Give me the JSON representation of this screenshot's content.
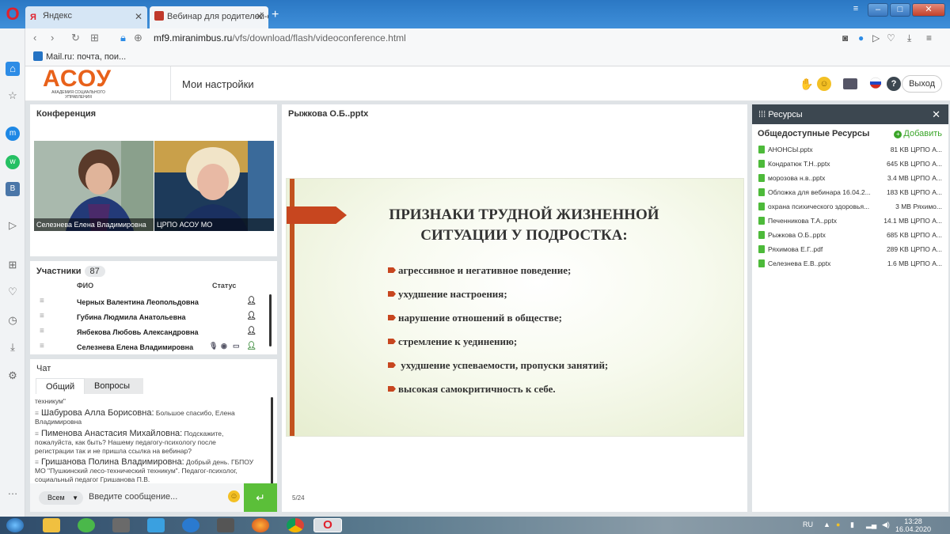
{
  "browser": {
    "tabs": [
      {
        "label": "Яндекс"
      },
      {
        "label": "Вебинар для родителей-с"
      }
    ],
    "url": {
      "host": "mf9.miranimbus.ru",
      "path": "/vfs/download/flash/videoconference.html"
    },
    "bookmark": "Mail.ru: почта, пои..."
  },
  "app": {
    "logo_text": "АСОУ",
    "logo_sub": "АКАДЕМИЯ СОЦИАЛЬНОГО УПРАВЛЕНИЯ",
    "settings_label": "Мои настройки",
    "exit_label": "Выход"
  },
  "conference": {
    "title": "Конференция",
    "videos": [
      {
        "name": "Селезнева Елена  Владимировна"
      },
      {
        "name": "ЦРПО АСОУ МО"
      }
    ]
  },
  "participants": {
    "title": "Участники",
    "count": "87",
    "col_name": "ФИО",
    "col_status": "Статус",
    "rows": [
      {
        "name": "Черных Валентина Леопольдовна"
      },
      {
        "name": "Губина Людмила Анатольевна"
      },
      {
        "name": "Янбекова Любовь Александровна"
      },
      {
        "name": "Селезнева Елена  Владимировна"
      }
    ]
  },
  "chat": {
    "title": "Чат",
    "tabs": [
      "Общий",
      "Вопросы"
    ],
    "messages": [
      {
        "author": "",
        "text": "техникум\""
      },
      {
        "author": "Шабурова Алла Борисовна:",
        "text": "Большое спасибо, Елена Владимировна"
      },
      {
        "author": "Пименова Анастасия Михайловна:",
        "text": "Подскажите, пожалуйста, как быть? Нашему педагогу-психологу после регистрации так и не пришла ссылка на вебинар?"
      },
      {
        "author": "Гришанова Полина Владимировна:",
        "text": "Добрый день. ГБПОУ МО \"Пушкинский лесо-технический техникум\". Педагог-психолог, социальный педагог Гришанова П.В."
      }
    ],
    "audience": "Всем",
    "input_placeholder": "Введите сообщение..."
  },
  "presentation": {
    "title": "Рыжкова О.Б..pptx",
    "slide_heading_1": "ПРИЗНАКИ ТРУДНОЙ ЖИЗНЕННОЙ",
    "slide_heading_2": "СИТУАЦИИ  У ПОДРОСТКА:",
    "bullets": [
      "агрессивное  и  негативное поведение;",
      "ухудшение настроения;",
      "нарушение отношений в обществе;",
      "стремление к уединению;",
      " ухудшение успеваемости, пропуски занятий;",
      "высокая самокритичность  к себе."
    ],
    "page": "5/24"
  },
  "resources": {
    "title": "Ресурсы",
    "subtitle": "Общедоступные Ресурсы",
    "add_label": "Добавить",
    "files": [
      {
        "name": "АНОНСЫ.pptx",
        "size": "81 KB ЦРПО А..."
      },
      {
        "name": "Кондратюк Т.Н..pptx",
        "size": "645 KB ЦРПО А..."
      },
      {
        "name": "морозова н.в..pptx",
        "size": "3.4 MB ЦРПО А..."
      },
      {
        "name": "Обложка для вебинара 16.04.2...",
        "size": "183 KB ЦРПО А..."
      },
      {
        "name": "охрана психического здоровья...",
        "size": "3 MB Ряхимо..."
      },
      {
        "name": "Печенникова Т.А..pptx",
        "size": "14.1 MB ЦРПО А..."
      },
      {
        "name": "Рыжкова О.Б..pptx",
        "size": "685 KB ЦРПО А..."
      },
      {
        "name": "Ряхимова Е.Г..pdf",
        "size": "289 KB ЦРПО А..."
      },
      {
        "name": "Селезнева Е.В..pptx",
        "size": "1.6 MB ЦРПО А..."
      }
    ]
  },
  "taskbar": {
    "lang": "RU",
    "time": "13:28",
    "date": "16.04.2020"
  }
}
